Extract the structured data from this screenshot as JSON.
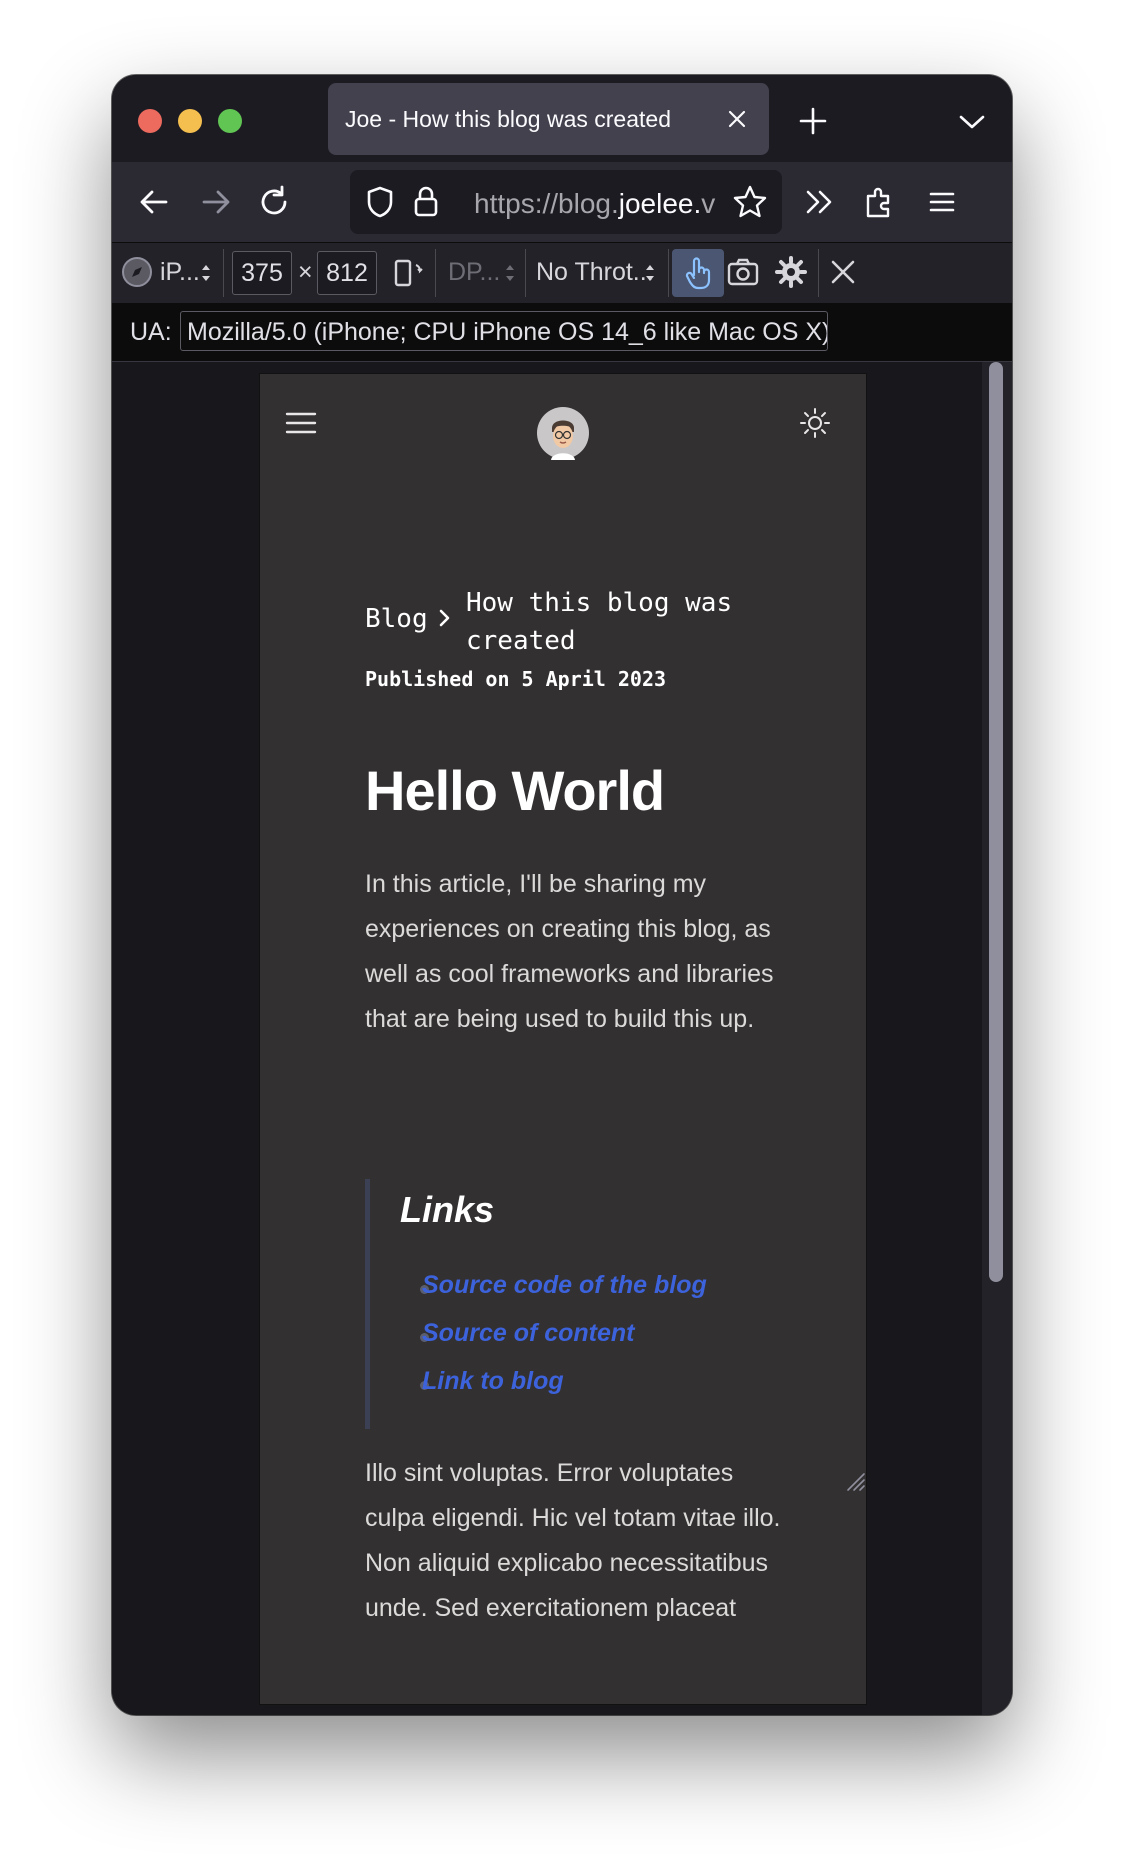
{
  "browser": {
    "tab_title": "Joe - How this blog was created",
    "url_host": "https://blog.",
    "url_domain": "joelee.",
    "url_rest": "v"
  },
  "devtools": {
    "device": "iP...",
    "width": "375",
    "times": "×",
    "height": "812",
    "dpr": "DP...",
    "throttle": "No Throt...",
    "ua_label": "UA:",
    "ua_value": "Mozilla/5.0 (iPhone; CPU iPhone OS 14_6 like Mac OS X)"
  },
  "page": {
    "breadcrumb_root": "Blog",
    "breadcrumb_current": "How this blog was created",
    "published": "Published on 5 April 2023",
    "title": "Hello World",
    "intro": "In this article, I'll be sharing my experiences on creating this blog, as well as cool frameworks and libraries that are being used to build this up.",
    "links_heading": "Links",
    "links": [
      "Source code of the blog",
      "Source of content",
      "Link to blog"
    ],
    "paragraph": "Illo sint voluptas. Error voluptates culpa eligendi. Hic vel totam vitae illo. Non aliquid explicabo necessitatibus unde. Sed exercitationem placeat"
  },
  "colors": {
    "link": "#3c62dc",
    "page_bg": "#333031",
    "accent_touch": "#4a5672"
  }
}
